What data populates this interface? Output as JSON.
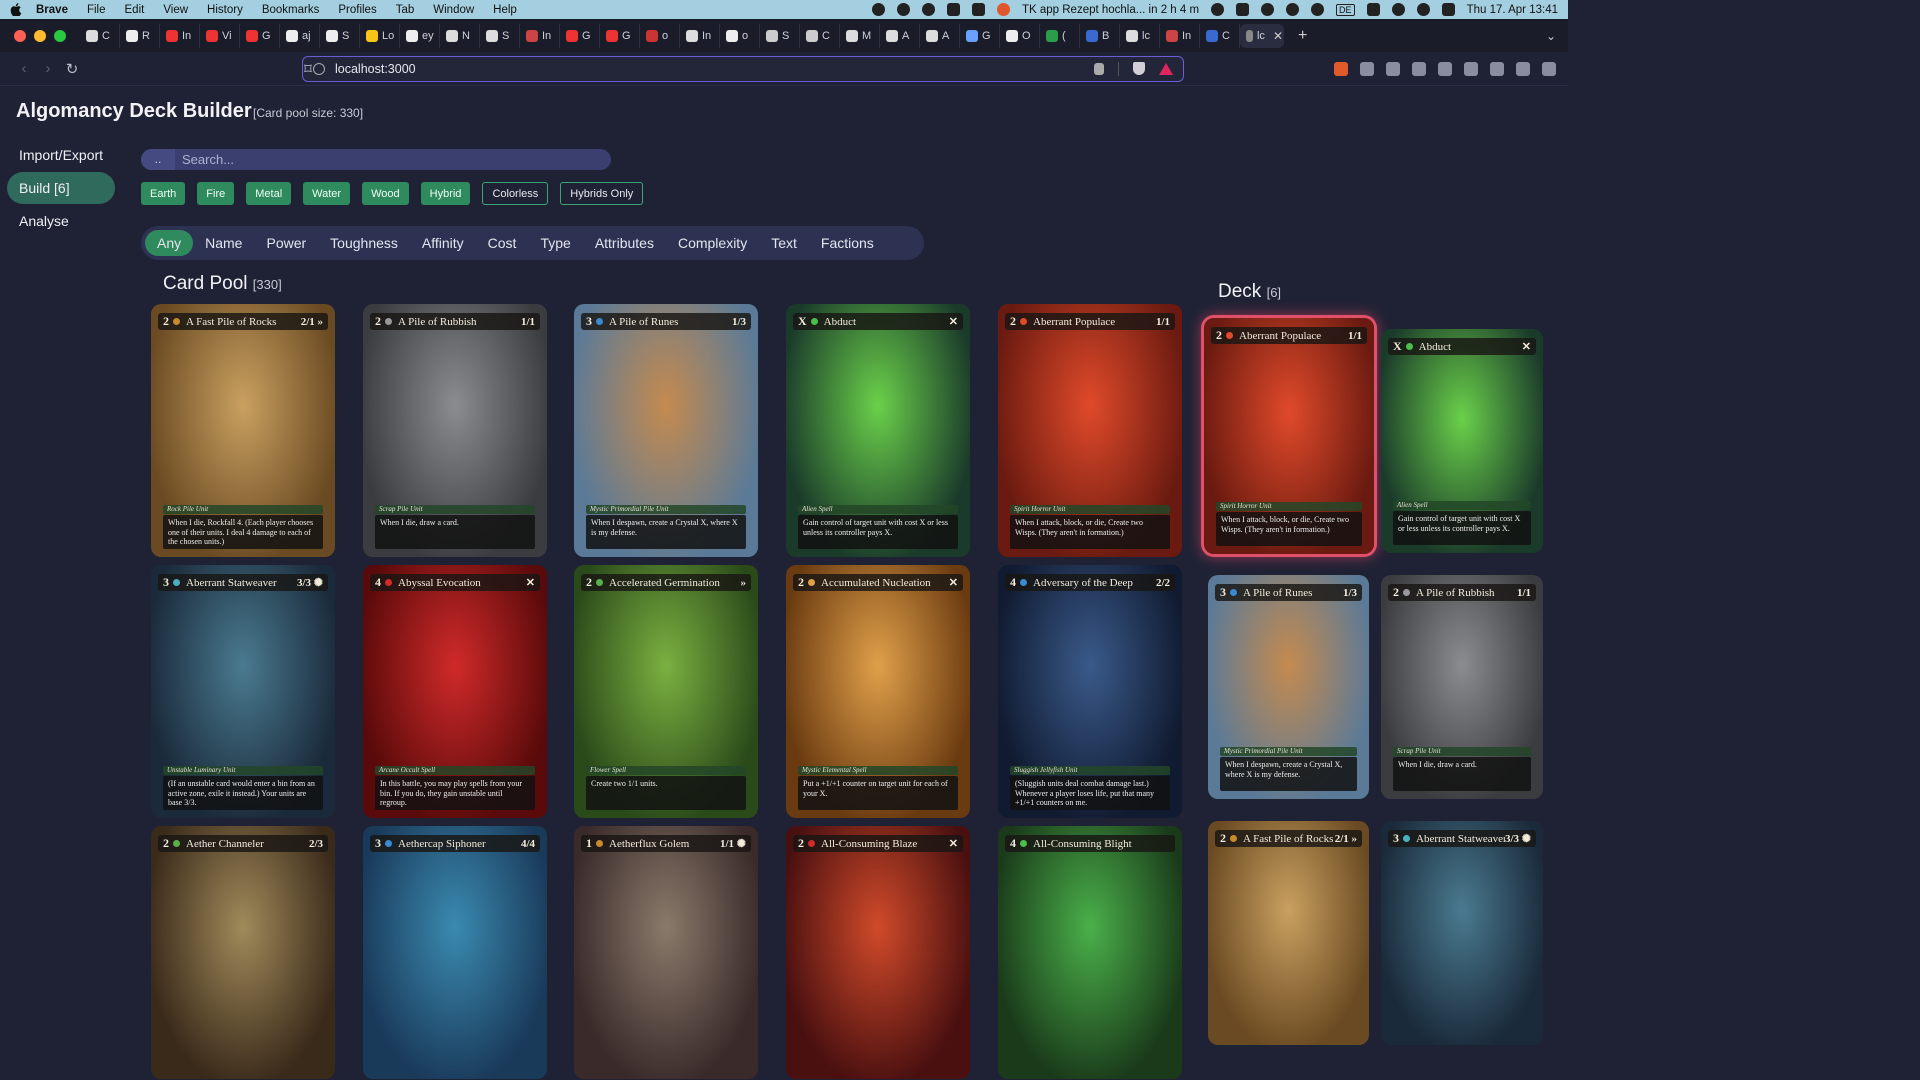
{
  "menubar": {
    "items": [
      "Brave",
      "File",
      "Edit",
      "View",
      "History",
      "Bookmarks",
      "Profiles",
      "Tab",
      "Window",
      "Help"
    ],
    "reminder": "TK app Rezept hochla... in 2 h 4 m",
    "input_source": "DE",
    "clock": "Thu 17. Apr  13:41"
  },
  "tabs": [
    {
      "label": "C",
      "color": "#ddd"
    },
    {
      "label": "R",
      "color": "#eee"
    },
    {
      "label": "In",
      "color": "#e33"
    },
    {
      "label": "Vi",
      "color": "#e33"
    },
    {
      "label": "G",
      "color": "#e33"
    },
    {
      "label": "aj",
      "color": "#eee"
    },
    {
      "label": "S",
      "color": "#eee"
    },
    {
      "label": "Lo",
      "color": "#f5c518"
    },
    {
      "label": "ey",
      "color": "#eee"
    },
    {
      "label": "N",
      "color": "#ddd"
    },
    {
      "label": "S",
      "color": "#ddd"
    },
    {
      "label": "In",
      "color": "#c44"
    },
    {
      "label": "G",
      "color": "#e33"
    },
    {
      "label": "G",
      "color": "#e33"
    },
    {
      "label": "o",
      "color": "#c33"
    },
    {
      "label": "In",
      "color": "#ddd"
    },
    {
      "label": "o",
      "color": "#eee"
    },
    {
      "label": "S",
      "color": "#ccc"
    },
    {
      "label": "C",
      "color": "#ccc"
    },
    {
      "label": "M",
      "color": "#ddd"
    },
    {
      "label": "A",
      "color": "#ddd"
    },
    {
      "label": "A",
      "color": "#ddd"
    },
    {
      "label": "G",
      "color": "#6aa0ff"
    },
    {
      "label": "O",
      "color": "#eee"
    },
    {
      "label": "(",
      "color": "#2a9d4a"
    },
    {
      "label": "B",
      "color": "#3a6ad0"
    },
    {
      "label": "lc",
      "color": "#ddd"
    },
    {
      "label": "In",
      "color": "#c44"
    },
    {
      "label": "C",
      "color": "#3a6ad0"
    },
    {
      "label": "lc",
      "color": "#888",
      "active": true
    }
  ],
  "address": {
    "url": "localhost:3000"
  },
  "app": {
    "title": "Algomancy Deck Builder",
    "subtitle": "[Card pool size: 330]",
    "nav": [
      {
        "label": "Import/Export",
        "active": false
      },
      {
        "label": "Build [6]",
        "active": true
      },
      {
        "label": "Analyse",
        "active": false
      }
    ],
    "search": {
      "prefix": "..",
      "placeholder": "Search..."
    },
    "filters": [
      {
        "label": "Earth",
        "style": "filled"
      },
      {
        "label": "Fire",
        "style": "filled"
      },
      {
        "label": "Metal",
        "style": "filled"
      },
      {
        "label": "Water",
        "style": "filled"
      },
      {
        "label": "Wood",
        "style": "filled"
      },
      {
        "label": "Hybrid",
        "style": "filled"
      },
      {
        "label": "Colorless",
        "style": "outline"
      },
      {
        "label": "Hybrids Only",
        "style": "outline"
      }
    ],
    "sorts": [
      "Any",
      "Name",
      "Power",
      "Toughness",
      "Affinity",
      "Cost",
      "Type",
      "Attributes",
      "Complexity",
      "Text",
      "Factions"
    ],
    "pool_title": "Card Pool",
    "pool_count": "[330]",
    "deck_title": "Deck",
    "deck_count": "[6]"
  },
  "pool_cards": [
    {
      "cost": "2",
      "name": "A Fast Pile of Rocks",
      "stat": "2/1 »",
      "type": "Rock Pile Unit",
      "text": "When I die, Rockfall 4. (Each player chooses one of their units. I deal 4 damage to each of the chosen units.)",
      "c1": "#c9a060",
      "c2": "#6a4a22",
      "gem": "#c88a2e"
    },
    {
      "cost": "2",
      "name": "A Pile of Rubbish",
      "stat": "1/1",
      "type": "Scrap Pile Unit",
      "text": "When I die, draw a card.",
      "c1": "#8a8c90",
      "c2": "#3a3c40",
      "gem": "#999"
    },
    {
      "cost": "3",
      "name": "A Pile of Runes",
      "stat": "1/3",
      "type": "Mystic Primordial Pile Unit",
      "text": "When I despawn, create a Crystal X, where X is my defense.",
      "c1": "#c58a4e",
      "c2": "#5a7a98",
      "gem": "#3a8ad0"
    },
    {
      "cost": "X",
      "name": "Abduct",
      "stat": "✕",
      "type": "Alien Spell",
      "text": "Gain control of target unit with cost X or less unless its controller pays X.",
      "c1": "#6ad04a",
      "c2": "#1a3a2a",
      "gem": "#4ac04a"
    },
    {
      "cost": "2",
      "name": "Aberrant Populace",
      "stat": "1/1",
      "type": "Spirit Horror Unit",
      "text": "When I attack, block, or die, Create two Wisps. (They aren't in formation.)",
      "c1": "#e04a2a",
      "c2": "#6a1a10",
      "gem": "#e04a2a"
    },
    {
      "cost": "3",
      "name": "Aberrant Statweaver",
      "stat": "3/3 ✺",
      "type": "Unstable Luminary Unit",
      "text": "(If an unstable card would enter a bin from an active zone, exile it instead.) Your units are base 3/3.",
      "c1": "#4a7a90",
      "c2": "#1a2a3a",
      "gem": "#4ab0c0"
    },
    {
      "cost": "4",
      "name": "Abyssal Evocation",
      "stat": "✕",
      "type": "Arcane Occult Spell",
      "text": "In this battle, you may play spells from your bin. If you do, they gain unstable until regroup.",
      "c1": "#d02a2a",
      "c2": "#5a0a0a",
      "gem": "#d02a2a"
    },
    {
      "cost": "2",
      "name": "Accelerated Germination",
      "stat": "»",
      "type": "Flower Spell",
      "text": "Create two 1/1 units.",
      "c1": "#7ab040",
      "c2": "#2a4a1a",
      "gem": "#5ab04a"
    },
    {
      "cost": "2",
      "name": "Accumulated Nucleation",
      "stat": "✕",
      "type": "Mystic Elemental Spell",
      "text": "Put a +1/+1 counter on target unit for each of your X.",
      "c1": "#e0a04a",
      "c2": "#6a3a10",
      "gem": "#e0a04a"
    },
    {
      "cost": "4",
      "name": "Adversary of the Deep",
      "stat": "2/2",
      "type": "Sluggish Jellyfish Unit",
      "text": "(Sluggish units deal combat damage last.) Whenever a player loses life, put that many +1/+1 counters on me.",
      "c1": "#3a5a8a",
      "c2": "#101a30",
      "gem": "#3a8ad0"
    },
    {
      "cost": "2",
      "name": "Aether Channeler",
      "stat": "2/3",
      "type": "",
      "text": "",
      "c1": "#a08a5a",
      "c2": "#3a2a1a",
      "gem": "#5ab04a"
    },
    {
      "cost": "3",
      "name": "Aethercap Siphoner",
      "stat": "4/4",
      "type": "",
      "text": "",
      "c1": "#3a8ab0",
      "c2": "#1a3a5a",
      "gem": "#3a8ad0"
    },
    {
      "cost": "1",
      "name": "Aetherflux Golem",
      "stat": "1/1 ✺",
      "type": "",
      "text": "",
      "c1": "#8a7a6a",
      "c2": "#3a2a2a",
      "gem": "#c88a2e"
    },
    {
      "cost": "2",
      "name": "All-Consuming Blaze",
      "stat": "✕",
      "type": "",
      "text": "",
      "c1": "#d04a2a",
      "c2": "#4a1010",
      "gem": "#d02a2a"
    },
    {
      "cost": "4",
      "name": "All-Consuming Blight",
      "stat": "",
      "type": "",
      "text": "",
      "c1": "#4ab04a",
      "c2": "#1a3a1a",
      "gem": "#4ac04a"
    }
  ],
  "deck_cards": [
    {
      "cost": "2",
      "name": "Aberrant Populace",
      "stat": "1/1",
      "type": "Spirit Horror Unit",
      "text": "When I attack, block, or die, Create two Wisps. (They aren't in formation.)",
      "c1": "#e04a2a",
      "c2": "#6a1a10",
      "gem": "#e04a2a",
      "selected": true
    },
    {
      "cost": "X",
      "name": "Abduct",
      "stat": "✕",
      "type": "Alien Spell",
      "text": "Gain control of target unit with cost X or less unless its controller pays X.",
      "c1": "#6ad04a",
      "c2": "#1a3a2a",
      "gem": "#4ac04a"
    },
    {
      "cost": "3",
      "name": "A Pile of Runes",
      "stat": "1/3",
      "type": "Mystic Primordial Pile Unit",
      "text": "When I despawn, create a Crystal X, where X is my defense.",
      "c1": "#c58a4e",
      "c2": "#5a7a98",
      "gem": "#3a8ad0"
    },
    {
      "cost": "2",
      "name": "A Pile of Rubbish",
      "stat": "1/1",
      "type": "Scrap Pile Unit",
      "text": "When I die, draw a card.",
      "c1": "#8a8c90",
      "c2": "#3a3c40",
      "gem": "#999"
    },
    {
      "cost": "2",
      "name": "A Fast Pile of Rocks",
      "stat": "2/1 »",
      "type": "",
      "text": "",
      "c1": "#c9a060",
      "c2": "#6a4a22",
      "gem": "#c88a2e"
    },
    {
      "cost": "3",
      "name": "Aberrant Statweaver",
      "stat": "3/3 ✺",
      "type": "",
      "text": "",
      "c1": "#4a7a90",
      "c2": "#1a2a3a",
      "gem": "#4ab0c0"
    }
  ]
}
